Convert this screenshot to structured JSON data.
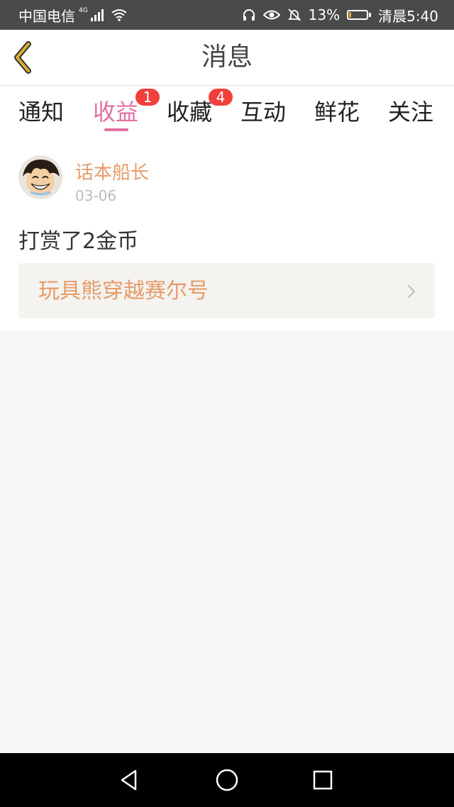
{
  "status_bar": {
    "carrier": "中国电信",
    "network": "4G",
    "battery": "13%",
    "battery_level": 0.13,
    "time": "清晨5:40",
    "icons": [
      "signal-icon",
      "wifi-icon",
      "headphone-icon",
      "eye-icon",
      "mute-bell-icon",
      "battery-icon"
    ]
  },
  "header": {
    "title": "消息",
    "back_icon": "chevron-left-icon"
  },
  "tabs": [
    {
      "label": "通知",
      "badge": ""
    },
    {
      "label": "收益",
      "badge": "1",
      "active": true
    },
    {
      "label": "收藏",
      "badge": "4"
    },
    {
      "label": "互动",
      "badge": ""
    },
    {
      "label": "鲜花",
      "badge": ""
    },
    {
      "label": "关注",
      "badge": ""
    }
  ],
  "message": {
    "sender": "话本船长",
    "date": "03-06",
    "text": "打赏了2金币",
    "work_title": "玩具熊穿越赛尔号"
  },
  "colors": {
    "accent": "#e26fa3",
    "badge": "#f1403c",
    "name": "#e69b6a",
    "back_icon": "#d9b030"
  },
  "nav_bar": {
    "icons": [
      "back-triangle-icon",
      "home-circle-icon",
      "recents-square-icon"
    ]
  }
}
